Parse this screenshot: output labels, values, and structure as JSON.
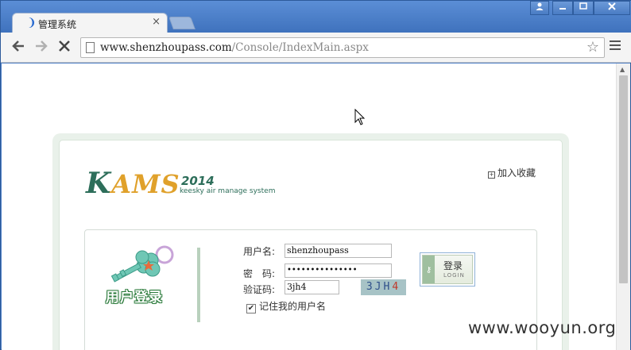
{
  "tab": {
    "title": "管理系统",
    "close": "×"
  },
  "toolbar": {
    "url_host": "www.shenzhoupass.com",
    "url_path": "/Console/IndexMain.aspx"
  },
  "page": {
    "logo": {
      "k": "K",
      "ams": "AMS",
      "year": "2014",
      "subtitle": "keesky air manage system"
    },
    "bookmark_label": "加入收藏",
    "key_caption": "用户登录",
    "form": {
      "username_label": "用户名:",
      "username_value": "shenzhoupass",
      "password_label": "密　码:",
      "password_value": "•••••••••••••••",
      "captcha_label": "验证码:",
      "captcha_value": "3jh4",
      "captcha_image_text": "3JH",
      "captcha_image_last": "4",
      "remember_label": "记住我的用户名",
      "remember_checked": true
    },
    "login_button": {
      "label": "登录",
      "sub": "LOGIN"
    }
  },
  "watermark": "www.wooyun.org"
}
